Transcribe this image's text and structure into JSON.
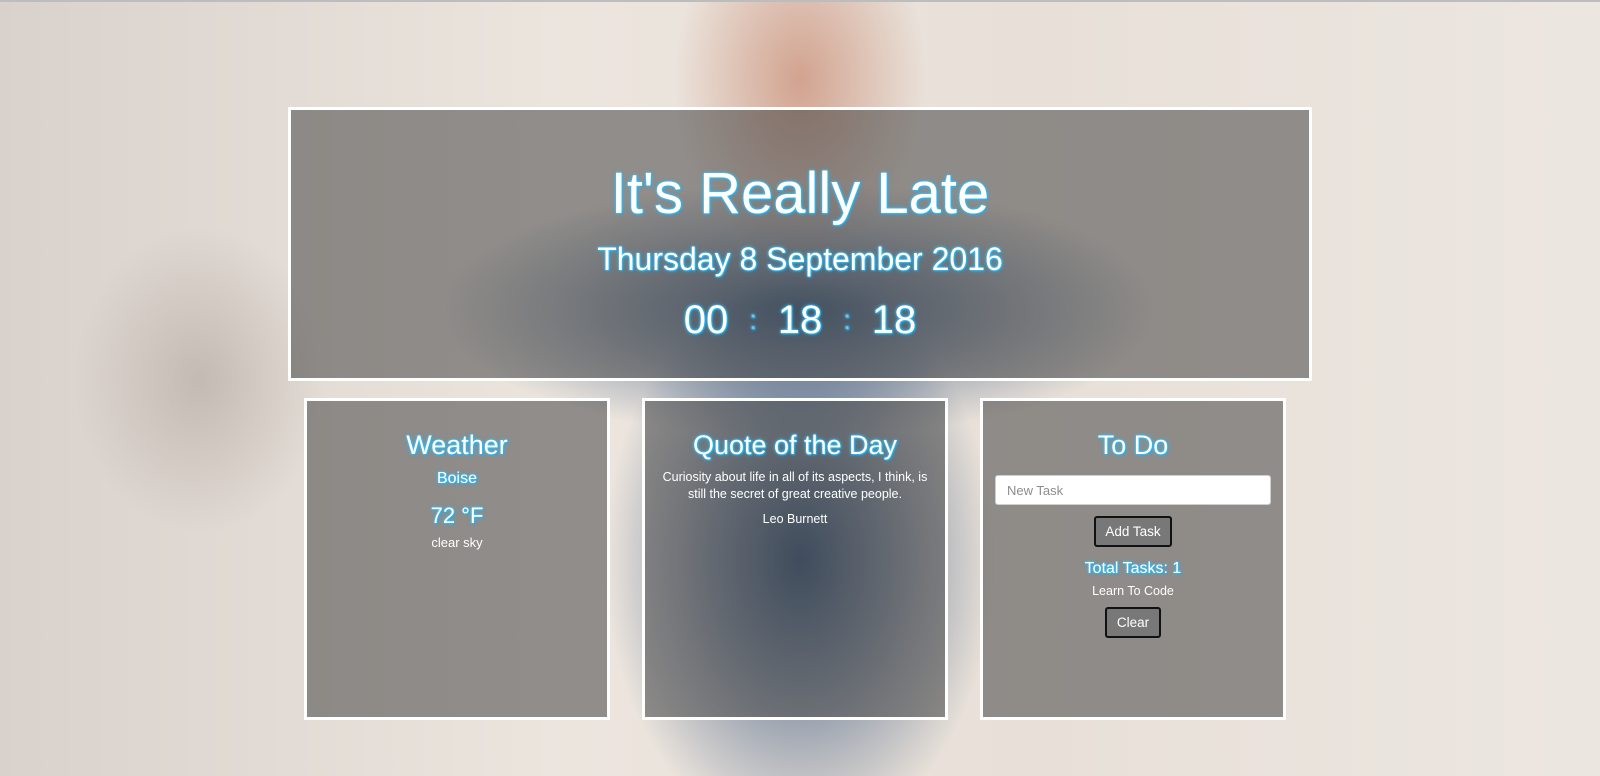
{
  "hero": {
    "greeting": "It's Really Late",
    "date": "Thursday 8 September 2016",
    "clock": {
      "hours": "00",
      "minutes": "18",
      "seconds": "18",
      "separator": ":"
    }
  },
  "weather": {
    "title": "Weather",
    "city": "Boise",
    "temperature": "72 °F",
    "condition": "clear sky"
  },
  "quote": {
    "title": "Quote of the Day",
    "text": "Curiosity about life in all of its aspects, I think, is still the secret of great creative people.",
    "author": "Leo Burnett"
  },
  "todo": {
    "title": "To Do",
    "input_placeholder": "New Task",
    "input_value": "",
    "add_label": "Add Task",
    "total_label": "Total Tasks: 1",
    "items": [
      "Learn To Code"
    ],
    "clear_label": "Clear"
  },
  "colors": {
    "text_glow": "#21b8ff",
    "panel_border": "#ffffff",
    "button_bg": "#787878"
  }
}
